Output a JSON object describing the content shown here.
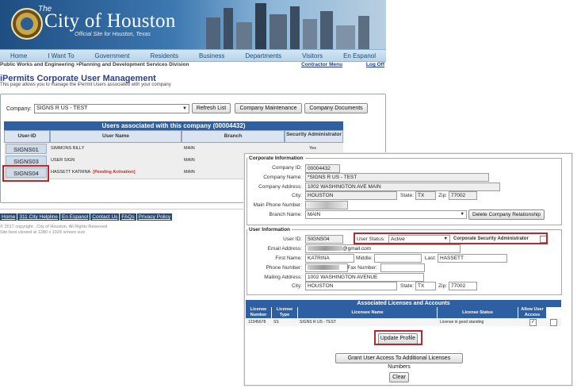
{
  "header": {
    "the": "The",
    "city_name": "City of Houston",
    "tagline": "Official Site for Houston, Texas"
  },
  "nav": [
    "Home",
    "I Want To",
    "Government",
    "Residents",
    "Business",
    "Departments",
    "Visitors",
    "En Espanol"
  ],
  "breadcrumb": {
    "path": "Public Works and Engineering >Planning and Development Services Division",
    "contractor_menu": "Contractor Menu",
    "log_off": "Log Off"
  },
  "page": {
    "title": "iPermits Corporate User Management",
    "subtitle": "This page allows you to manage the iPermit Users associated with your company"
  },
  "company": {
    "label": "Company:",
    "selected": "SIGNS R US - TEST",
    "buttons": [
      "Refresh List",
      "Company Maintenance",
      "Company Documents"
    ]
  },
  "users_table": {
    "title": "Users associated with this company (00004432)",
    "headers": [
      "User-ID",
      "User Name",
      "Branch",
      "Security Administrator"
    ],
    "rows": [
      {
        "id": "SIGNS01",
        "name": "SIMMONS BILLY",
        "status": "",
        "branch": "MAIN",
        "admin": "Yes"
      },
      {
        "id": "SIGNS03",
        "name": "USER SIGN",
        "status": "",
        "branch": "MAIN",
        "admin": ""
      },
      {
        "id": "SIGNS04",
        "name": "HASSETT KATRINA",
        "status": "[Pending Activation]",
        "branch": "MAIN",
        "admin": ""
      }
    ]
  },
  "footer": {
    "links": [
      "Home",
      "311 City Helpline",
      "En Espanol",
      "Contact Us",
      "FAQs",
      "Privacy Policy"
    ],
    "copyright": "© 2017 copyright . City of Houston. All Rights Reserved",
    "best_viewed": "Site best viewed at 1280 x 1024 screen size"
  },
  "corporate_info": {
    "legend": "Corporate Information",
    "company_id_label": "Company ID:",
    "company_id": "00004432",
    "company_name_label": "Company Name:",
    "company_name": "*SIGNS R US - TEST",
    "company_address_label": "Company Address:",
    "company_address": "1002 WASHINGTON AVE MAIN",
    "city_label": "City:",
    "city": "HOUSTON",
    "state_label": "State:",
    "state": "TX",
    "zip_label": "Zip:",
    "zip": "77002",
    "main_phone_label": "Main Phone Number:",
    "branch_name_label": "Branch Name:",
    "branch_name": "MAIN",
    "delete_button": "Delete Company Relationship"
  },
  "user_info": {
    "legend": "User Information",
    "user_id_label": "User ID:",
    "user_id": "SIGNS04",
    "user_status_label": "User Status:",
    "user_status": "Active",
    "corp_admin_label": "Corporate Security Administrator",
    "email_label": "Email Address:",
    "email_suffix": "@gmail.com",
    "first_name_label": "First Name:",
    "first_name": "KATRINA",
    "middle_label": "Middle:",
    "last_label": "Last:",
    "last_name": "HASSETT",
    "phone_label": "Phone Number:",
    "fax_label": "Fax Number:",
    "mailing_label": "Mailing Address:",
    "mailing_address": "1002 WASHINGTON AVENUE",
    "city_label": "City:",
    "city": "HOUSTON",
    "state_label": "State:",
    "state": "TX",
    "zip_label": "Zip:",
    "zip": "77002"
  },
  "licenses": {
    "title": "Associated Licenses and Accounts",
    "headers": [
      "License Number",
      "License Type",
      "Licensee Name",
      "License Status",
      "Allow User Access"
    ],
    "rows": [
      {
        "number": "12345678",
        "type": "SS",
        "name": "SIGNS R US - TEST",
        "status": "License in good standing"
      }
    ]
  },
  "actions": {
    "update": "Update Profile",
    "grant": "Grant User Access To Additional Licenses Numbers",
    "clear": "Clear"
  },
  "colors": {
    "accent": "#2f5fa3",
    "highlight": "#b8282e",
    "pending": "#dd2222"
  }
}
